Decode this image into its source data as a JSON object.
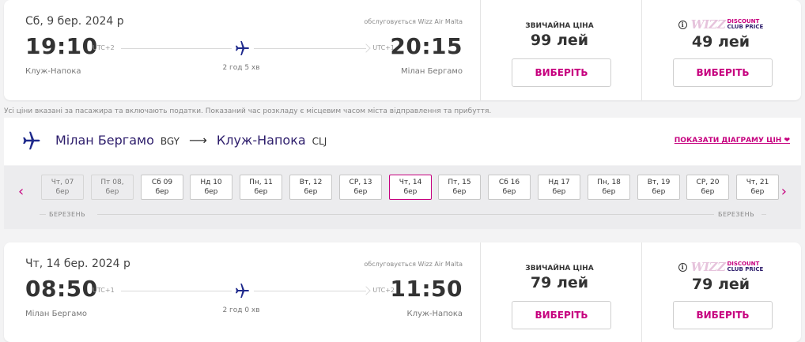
{
  "outbound": {
    "date": "Сб, 9 бер. 2024 р",
    "operated_by": "обслуговується Wizz Air Malta",
    "departure_time": "19:10",
    "departure_utc": "UTC+2",
    "arrival_time": "20:15",
    "arrival_utc": "UTC+1",
    "duration": "2 год 5 хв",
    "departure_city": "Клуж-Напока",
    "arrival_city": "Мілан Бергамо",
    "standard_label": "ЗВИЧАЙНА ЦІНА",
    "standard_price": "99 лей",
    "club_price": "49 лей",
    "select_label": "ВИБЕРІТЬ"
  },
  "club_logo": {
    "wizz": "WIZZ",
    "line1": "DISCOUNT",
    "line2": "CLUB PRICE",
    "info": "i"
  },
  "disclaimer": "Усі ціни вказані за пасажира та включають податки. Показаний час розкладу є місцевим часом міста відправлення та прибуття.",
  "route": {
    "from_city": "Мілан Бергамо",
    "from_code": "BGY",
    "arrow": "⟶",
    "to_city": "Клуж-Напока",
    "to_code": "CLJ",
    "chart_link": "ПОКАЗАТИ ДІАГРАМУ ЦІН ❤"
  },
  "date_strip": {
    "prev": "‹",
    "next": "›",
    "month_left": "БЕРЕЗЕНЬ",
    "month_right": "БЕРЕЗЕНЬ",
    "days": [
      {
        "l1": "Чт, 07",
        "l2": "бер",
        "state": "disabled"
      },
      {
        "l1": "Пт 08,",
        "l2": "бер",
        "state": "disabled"
      },
      {
        "l1": "Сб 09",
        "l2": "бер",
        "state": "normal"
      },
      {
        "l1": "Нд 10",
        "l2": "бер",
        "state": "normal"
      },
      {
        "l1": "Пн, 11",
        "l2": "бер",
        "state": "normal"
      },
      {
        "l1": "Вт, 12",
        "l2": "бер",
        "state": "normal"
      },
      {
        "l1": "СР, 13",
        "l2": "бер",
        "state": "normal"
      },
      {
        "l1": "Чт, 14",
        "l2": "бер",
        "state": "selected"
      },
      {
        "l1": "Пт, 15",
        "l2": "бер",
        "state": "normal"
      },
      {
        "l1": "Сб 16",
        "l2": "бер",
        "state": "normal"
      },
      {
        "l1": "Нд 17",
        "l2": "бер",
        "state": "normal"
      },
      {
        "l1": "Пн, 18",
        "l2": "бер",
        "state": "normal"
      },
      {
        "l1": "Вт, 19",
        "l2": "бер",
        "state": "normal"
      },
      {
        "l1": "СР, 20",
        "l2": "бер",
        "state": "normal"
      },
      {
        "l1": "Чт, 21",
        "l2": "бер",
        "state": "normal"
      }
    ]
  },
  "return": {
    "date": "Чт, 14 бер. 2024 р",
    "operated_by": "обслуговується Wizz Air Malta",
    "departure_time": "08:50",
    "departure_utc": "UTC+1",
    "arrival_time": "11:50",
    "arrival_utc": "UTC+2",
    "duration": "2 год 0 хв",
    "departure_city": "Мілан Бергамо",
    "arrival_city": "Клуж-Напока",
    "standard_label": "ЗВИЧАЙНА ЦІНА",
    "standard_price": "79 лей",
    "club_price": "79 лей",
    "select_label": "ВИБЕРІТЬ"
  },
  "colors": {
    "brand_pink": "#c6007e",
    "brand_navy": "#2d1d6b",
    "plane_blue": "#1f2a8c"
  }
}
